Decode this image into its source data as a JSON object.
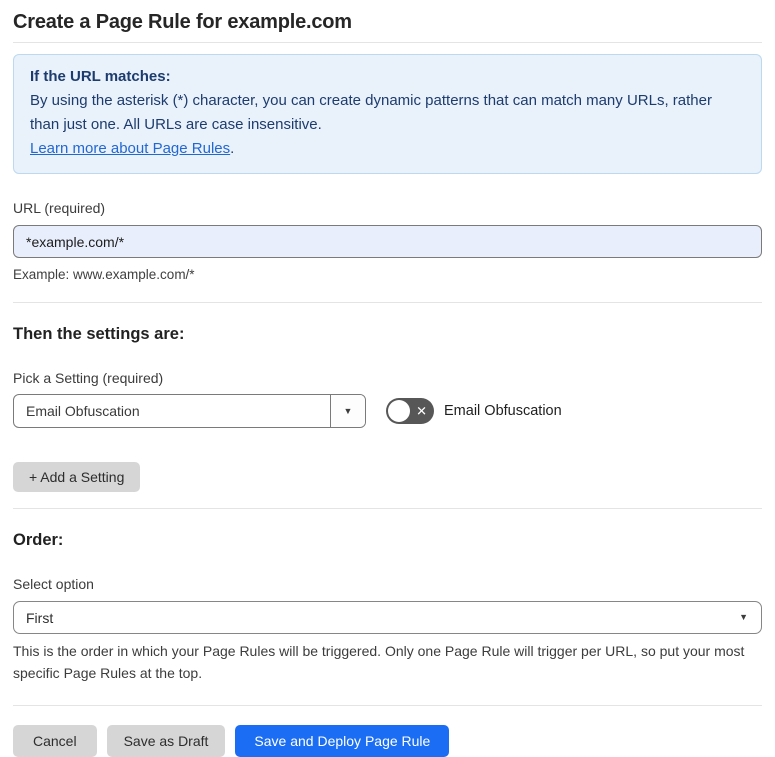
{
  "page": {
    "title": "Create a Page Rule for example.com"
  },
  "info_box": {
    "heading": "If the URL matches:",
    "body": "By using the asterisk (*) character, you can create dynamic patterns that can match many URLs, rather than just one. All URLs are case insensitive.",
    "link_label": "Learn more about Page Rules",
    "link_suffix": "."
  },
  "url_field": {
    "label": "URL (required)",
    "value": "*example.com/*",
    "helper": "Example: www.example.com/*"
  },
  "settings_section": {
    "heading": "Then the settings are:",
    "picker_label": "Pick a Setting (required)",
    "picker_value": "Email Obfuscation",
    "toggle_label": "Email Obfuscation",
    "toggle_state": "off",
    "add_setting_label": "+ Add a Setting"
  },
  "order_section": {
    "heading": "Order:",
    "select_label": "Select option",
    "select_value": "First",
    "helper": "This is the order in which your Page Rules will be triggered. Only one Page Rule will trigger per URL, so put your most specific Page Rules at the top."
  },
  "footer": {
    "cancel_label": "Cancel",
    "save_draft_label": "Save as Draft",
    "save_deploy_label": "Save and Deploy Page Rule"
  },
  "icons": {
    "dropdown_caret": "▼",
    "toggle_x": "✕"
  },
  "colors": {
    "accent_blue": "#1b6ef3",
    "info_bg": "#e9f1fb",
    "info_border": "#bcd9f1",
    "info_text": "#1d3c6e",
    "link_blue": "#2268d3",
    "input_bg": "#e8eefb",
    "toggle_off_bg": "#575757",
    "button_gray": "#d6d6d6"
  }
}
